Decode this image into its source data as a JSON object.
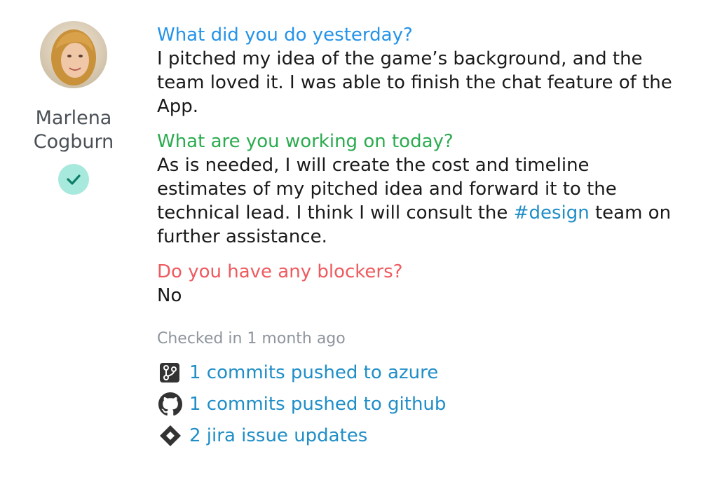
{
  "user": {
    "name_first": "Marlena",
    "name_last": "Cogburn",
    "avatar_icon": "user-avatar",
    "status_icon": "check-icon",
    "status_color": "#a7e9dd"
  },
  "standup": {
    "yesterday_question": "What did you do yesterday?",
    "yesterday_answer": "I pitched my idea of the game’s background, and the team loved it. I was able to finish the chat feature of the App.",
    "today_question": "What are you working on today?",
    "today_answer_prefix": "As is needed, I will create the cost and timeline estimates of my pitched idea and forward it to the technical lead. I think I will consult the ",
    "today_answer_link": "#design",
    "today_answer_suffix": " team on further assistance.",
    "blockers_question": "Do you have any blockers?",
    "blockers_answer": "No"
  },
  "checked_in": "Checked in 1 month ago",
  "activity": [
    {
      "icon": "azure-repos-icon",
      "text": "1 commits pushed to azure"
    },
    {
      "icon": "github-icon",
      "text": "1 commits pushed to github"
    },
    {
      "icon": "jira-icon",
      "text": "2 jira issue updates"
    }
  ],
  "colors": {
    "yesterday": "#2593e8",
    "today": "#2bab4f",
    "blockers": "#ef5a5f",
    "link": "#1f8ec7"
  }
}
